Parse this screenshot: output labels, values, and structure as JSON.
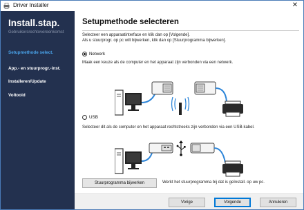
{
  "window": {
    "title": "Driver Installer"
  },
  "sidebar": {
    "heading": "Install.stap.",
    "steps": [
      {
        "label": "Gebruikersrechtovereenkomst"
      },
      {
        "label": "Setupmethode select."
      },
      {
        "label": "App.- en stuurprogr.-inst."
      },
      {
        "label": "Installeren/Update"
      },
      {
        "label": "Voltooid"
      }
    ]
  },
  "main": {
    "title": "Setupmethode selecteren",
    "instruction_line1": "Selecteer een apparaatinterface en klik dan op [Volgende].",
    "instruction_line2": "Als u stuurprogr. op pc wilt bijwerken, klik dan op [Stuurprogramma bijwerken].",
    "options": [
      {
        "label": "Netwerk",
        "selected": true,
        "description": "Maak een keuze als de computer en het apparaat zijn verbonden via een netwerk."
      },
      {
        "label": "USB",
        "selected": false,
        "description": "Selecteer dit als de computer en het apparaat rechtstreeks zijn verbonden via een USB-kabel."
      }
    ],
    "update_button": "Stuurprogramma bijwerken",
    "update_description": "Werkt het stuurprogramma bij dat is geïnstall. op uw pc."
  },
  "footer": {
    "back": "Vorige",
    "next": "Volgende",
    "cancel": "Annuleren"
  },
  "colors": {
    "sidebar_bg": "#23314f",
    "active_step": "#49a3ea",
    "cable_blue": "#2e86d9",
    "accent_border": "#0078d7"
  }
}
